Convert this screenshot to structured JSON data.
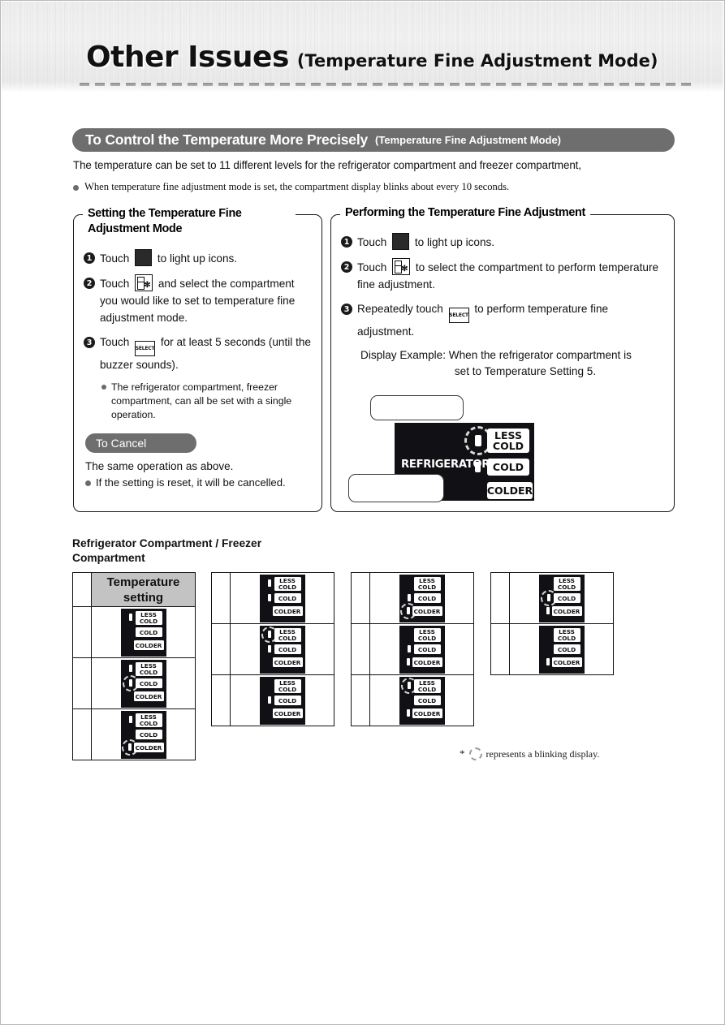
{
  "header": {
    "main_title": "Other Issues",
    "sub_title": "(Temperature Fine Adjustment Mode)"
  },
  "section": {
    "pill_main": "To Control the Temperature More Precisely",
    "pill_sub": "(Temperature Fine Adjustment Mode)",
    "intro": "The temperature can be set to 11  different levels for the refrigerator compartment and freezer compartment,",
    "bullet": "When temperature fine adjustment mode is set, the compartment display blinks about every 10 seconds."
  },
  "left_panel": {
    "title": "Setting the Temperature Fine Adjustment Mode",
    "steps": [
      {
        "num": "1",
        "pre": "Touch",
        "icon": "grid-key-icon",
        "post": "to light up icons."
      },
      {
        "num": "2",
        "pre": "Touch",
        "icon": "compartment-select-key-icon",
        "post": "and select the compartment you would like to set to temperature fine adjustment mode."
      },
      {
        "num": "3",
        "pre": "Touch",
        "icon": "select-key-icon",
        "post": "for at least 5 seconds (until the buzzer sounds)."
      }
    ],
    "sub_bullet": "The refrigerator compartment, freezer compartment, can all be set with a single operation.",
    "cancel_label": "To Cancel",
    "cancel_line": "The same operation as above.",
    "cancel_bullet": "If the setting is reset, it will be cancelled."
  },
  "right_panel": {
    "title": "Performing the Temperature Fine Adjustment",
    "steps": [
      {
        "num": "1",
        "pre": "Touch",
        "icon": "grid-key-icon",
        "post": "to light up icons."
      },
      {
        "num": "2",
        "pre": "Touch",
        "icon": "compartment-select-key-icon",
        "post": "to select the compartment to perform temperature fine adjustment."
      },
      {
        "num": "3",
        "pre": "Repeatedly touch",
        "icon": "select-key-icon",
        "post": "to perform temperature fine adjustment."
      }
    ],
    "example_line1": "Display Example: When the refrigerator compartment is",
    "example_line2": "set to Temperature Setting 5.",
    "display": {
      "compartment_label": "REFRIGERATOR",
      "labels": {
        "less_cold": "LESS COLD",
        "cold": "COLD",
        "colder": "COLDER"
      },
      "led_less_cold": "on-blinking",
      "led_cold": "on",
      "led_colder": "off",
      "callout_top_text": "",
      "callout_bottom_text": ""
    }
  },
  "table_section": {
    "heading": "Refrigerator Compartment / Freezer Compartment",
    "column_header": "Temperature setting",
    "labels": {
      "less_cold": "LESS COLD",
      "cold": "COLD",
      "colder": "COLDER"
    },
    "footnote": "represents a blinking display.",
    "footnote_star": "*",
    "columns": [
      {
        "has_header": true,
        "rows": [
          {
            "less_cold": "on",
            "cold": "off",
            "colder": "off"
          },
          {
            "less_cold": "on",
            "cold": "blinking",
            "colder": "off"
          },
          {
            "less_cold": "on",
            "cold": "off",
            "colder": "blinking"
          }
        ]
      },
      {
        "has_header": false,
        "rows": [
          {
            "less_cold": "on",
            "cold": "on",
            "colder": "off"
          },
          {
            "less_cold": "blinking",
            "cold": "on",
            "colder": "off"
          },
          {
            "less_cold": "off",
            "cold": "on",
            "colder": "off"
          }
        ]
      },
      {
        "has_header": false,
        "rows": [
          {
            "less_cold": "off",
            "cold": "on",
            "colder": "blinking"
          },
          {
            "less_cold": "off",
            "cold": "on",
            "colder": "on"
          },
          {
            "less_cold": "blinking",
            "cold": "off",
            "colder": "on"
          }
        ]
      },
      {
        "has_header": false,
        "rows": [
          {
            "less_cold": "off",
            "cold": "blinking",
            "colder": "on"
          },
          {
            "less_cold": "off",
            "cold": "off",
            "colder": "on"
          }
        ]
      }
    ]
  }
}
